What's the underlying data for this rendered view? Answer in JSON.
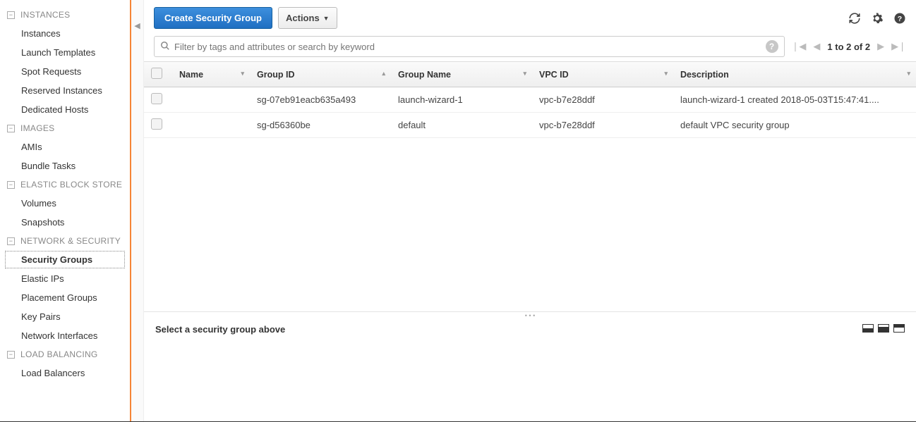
{
  "sidebar": {
    "groups": [
      {
        "title": "INSTANCES",
        "items": [
          "Instances",
          "Launch Templates",
          "Spot Requests",
          "Reserved Instances",
          "Dedicated Hosts"
        ]
      },
      {
        "title": "IMAGES",
        "items": [
          "AMIs",
          "Bundle Tasks"
        ]
      },
      {
        "title": "ELASTIC BLOCK STORE",
        "items": [
          "Volumes",
          "Snapshots"
        ]
      },
      {
        "title": "NETWORK & SECURITY",
        "items": [
          "Security Groups",
          "Elastic IPs",
          "Placement Groups",
          "Key Pairs",
          "Network Interfaces"
        ],
        "active": "Security Groups"
      },
      {
        "title": "LOAD BALANCING",
        "items": [
          "Load Balancers"
        ]
      }
    ]
  },
  "toolbar": {
    "create_label": "Create Security Group",
    "actions_label": "Actions"
  },
  "search": {
    "placeholder": "Filter by tags and attributes or search by keyword"
  },
  "pagination": {
    "label": "1 to 2 of 2"
  },
  "table": {
    "columns": [
      "Name",
      "Group ID",
      "Group Name",
      "VPC ID",
      "Description"
    ],
    "rows": [
      {
        "name": "",
        "group_id": "sg-07eb91eacb635a493",
        "group_name": "launch-wizard-1",
        "vpc_id": "vpc-b7e28ddf",
        "description": "launch-wizard-1 created 2018-05-03T15:47:41...."
      },
      {
        "name": "",
        "group_id": "sg-d56360be",
        "group_name": "default",
        "vpc_id": "vpc-b7e28ddf",
        "description": "default VPC security group"
      }
    ]
  },
  "bottom": {
    "message": "Select a security group above"
  }
}
